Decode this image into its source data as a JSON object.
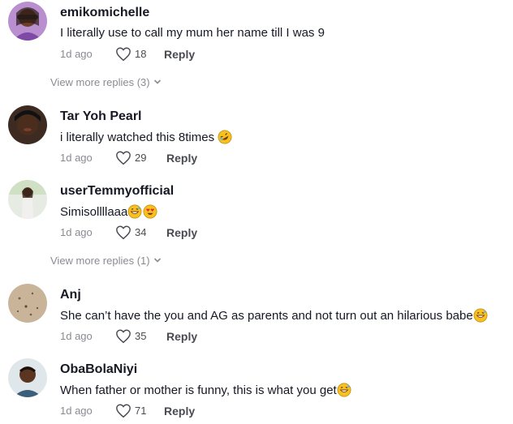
{
  "comments": [
    {
      "username": "emikomichelle",
      "text": "I literally use to call my mum her name till I was 9",
      "time": "1d ago",
      "likes": "18",
      "reply_label": "Reply",
      "avatar": "avatar-emikomichelle"
    },
    {
      "username": "Tar Yoh Pearl",
      "text": "i literally watched this 8times",
      "emoji": "rofl-emoji",
      "time": "1d ago",
      "likes": "29",
      "reply_label": "Reply",
      "avatar": "avatar-taryohpearl"
    },
    {
      "username": "userTemmyofficial",
      "text": "Simisollllaaa",
      "emoji": [
        "grinning-sweat-emoji",
        "heart-eyes-emoji"
      ],
      "time": "1d ago",
      "likes": "34",
      "reply_label": "Reply",
      "avatar": "avatar-usertemmyofficial"
    },
    {
      "username": "Anj",
      "text": "She can’t have the you and AG as parents and not turn out an hilarious babe",
      "emoji": "grinning-sweat-emoji",
      "time": "1d ago",
      "likes": "35",
      "reply_label": "Reply",
      "avatar": "avatar-anj"
    },
    {
      "username": "ObaBolaNiyi",
      "text": "When father or mother is funny, this is what you get",
      "emoji": "grinning-sweat-emoji",
      "time": "1d ago",
      "likes": "71",
      "reply_label": "Reply",
      "avatar": "avatar-obabolaniyi"
    }
  ],
  "view_more": [
    {
      "label": "View more replies (3)"
    },
    {
      "label": "View more replies (1)"
    }
  ],
  "colors": {
    "text": "#161823",
    "muted": "#8a8b91",
    "secondary": "#4a4b52"
  }
}
